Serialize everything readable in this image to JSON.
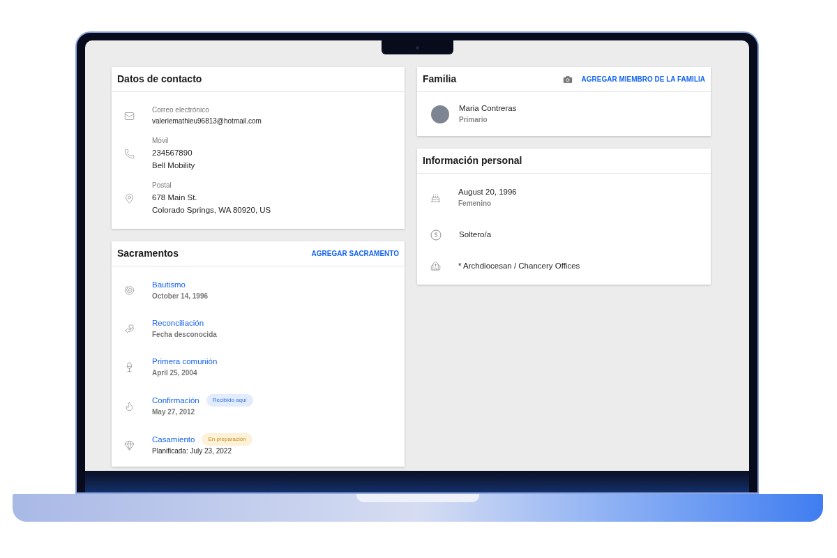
{
  "contact": {
    "title": "Datos de contacto",
    "rows": [
      {
        "kind": "email",
        "label": "Correo electrónico",
        "lines": [
          "valeriemathieu96813@hotmail.com"
        ]
      },
      {
        "kind": "phone",
        "label": "Móvil",
        "lines": [
          "234567890",
          "Bell Mobility"
        ]
      },
      {
        "kind": "postal",
        "label": "Postal",
        "lines": [
          "678 Main St.",
          "Colorado Springs, WA 80920, US"
        ]
      }
    ]
  },
  "sacraments": {
    "title": "Sacramentos",
    "action": "AGREGAR SACRAMENTO",
    "items": [
      {
        "kind": "baptism",
        "name": "Bautismo",
        "date": "October 14, 1996",
        "planned": false
      },
      {
        "kind": "reconciliation",
        "name": "Reconciliación",
        "date": "Fecha desconocida",
        "planned": false
      },
      {
        "kind": "communion",
        "name": "Primera comunión",
        "date": "April 25, 2004",
        "planned": false
      },
      {
        "kind": "confirmation",
        "name": "Confirmación",
        "date": "May 27, 2012",
        "planned": false,
        "badge": {
          "kind": "received",
          "text": "Recibido aquí",
          "color": "#e2ecfc"
        }
      },
      {
        "kind": "marriage",
        "name": "Casamiento",
        "date": "Planificada: July 23, 2022",
        "planned": true,
        "badge": {
          "kind": "preparing",
          "text": "En preparación",
          "color": "#fdf1d8"
        }
      }
    ]
  },
  "family": {
    "title": "Familia",
    "action": "AGREGAR MIEMBRO DE LA FAMILIA",
    "members": [
      {
        "name": "Maria Contreras",
        "role": "Primario"
      }
    ]
  },
  "personal": {
    "title": "Información personal",
    "rows": [
      {
        "kind": "birthday",
        "value": "August 20, 1996",
        "sub": "Femenino"
      },
      {
        "kind": "marital",
        "value": "Soltero/a"
      },
      {
        "kind": "parish",
        "value": "* Archdiocesan / Chancery Offices"
      }
    ]
  }
}
